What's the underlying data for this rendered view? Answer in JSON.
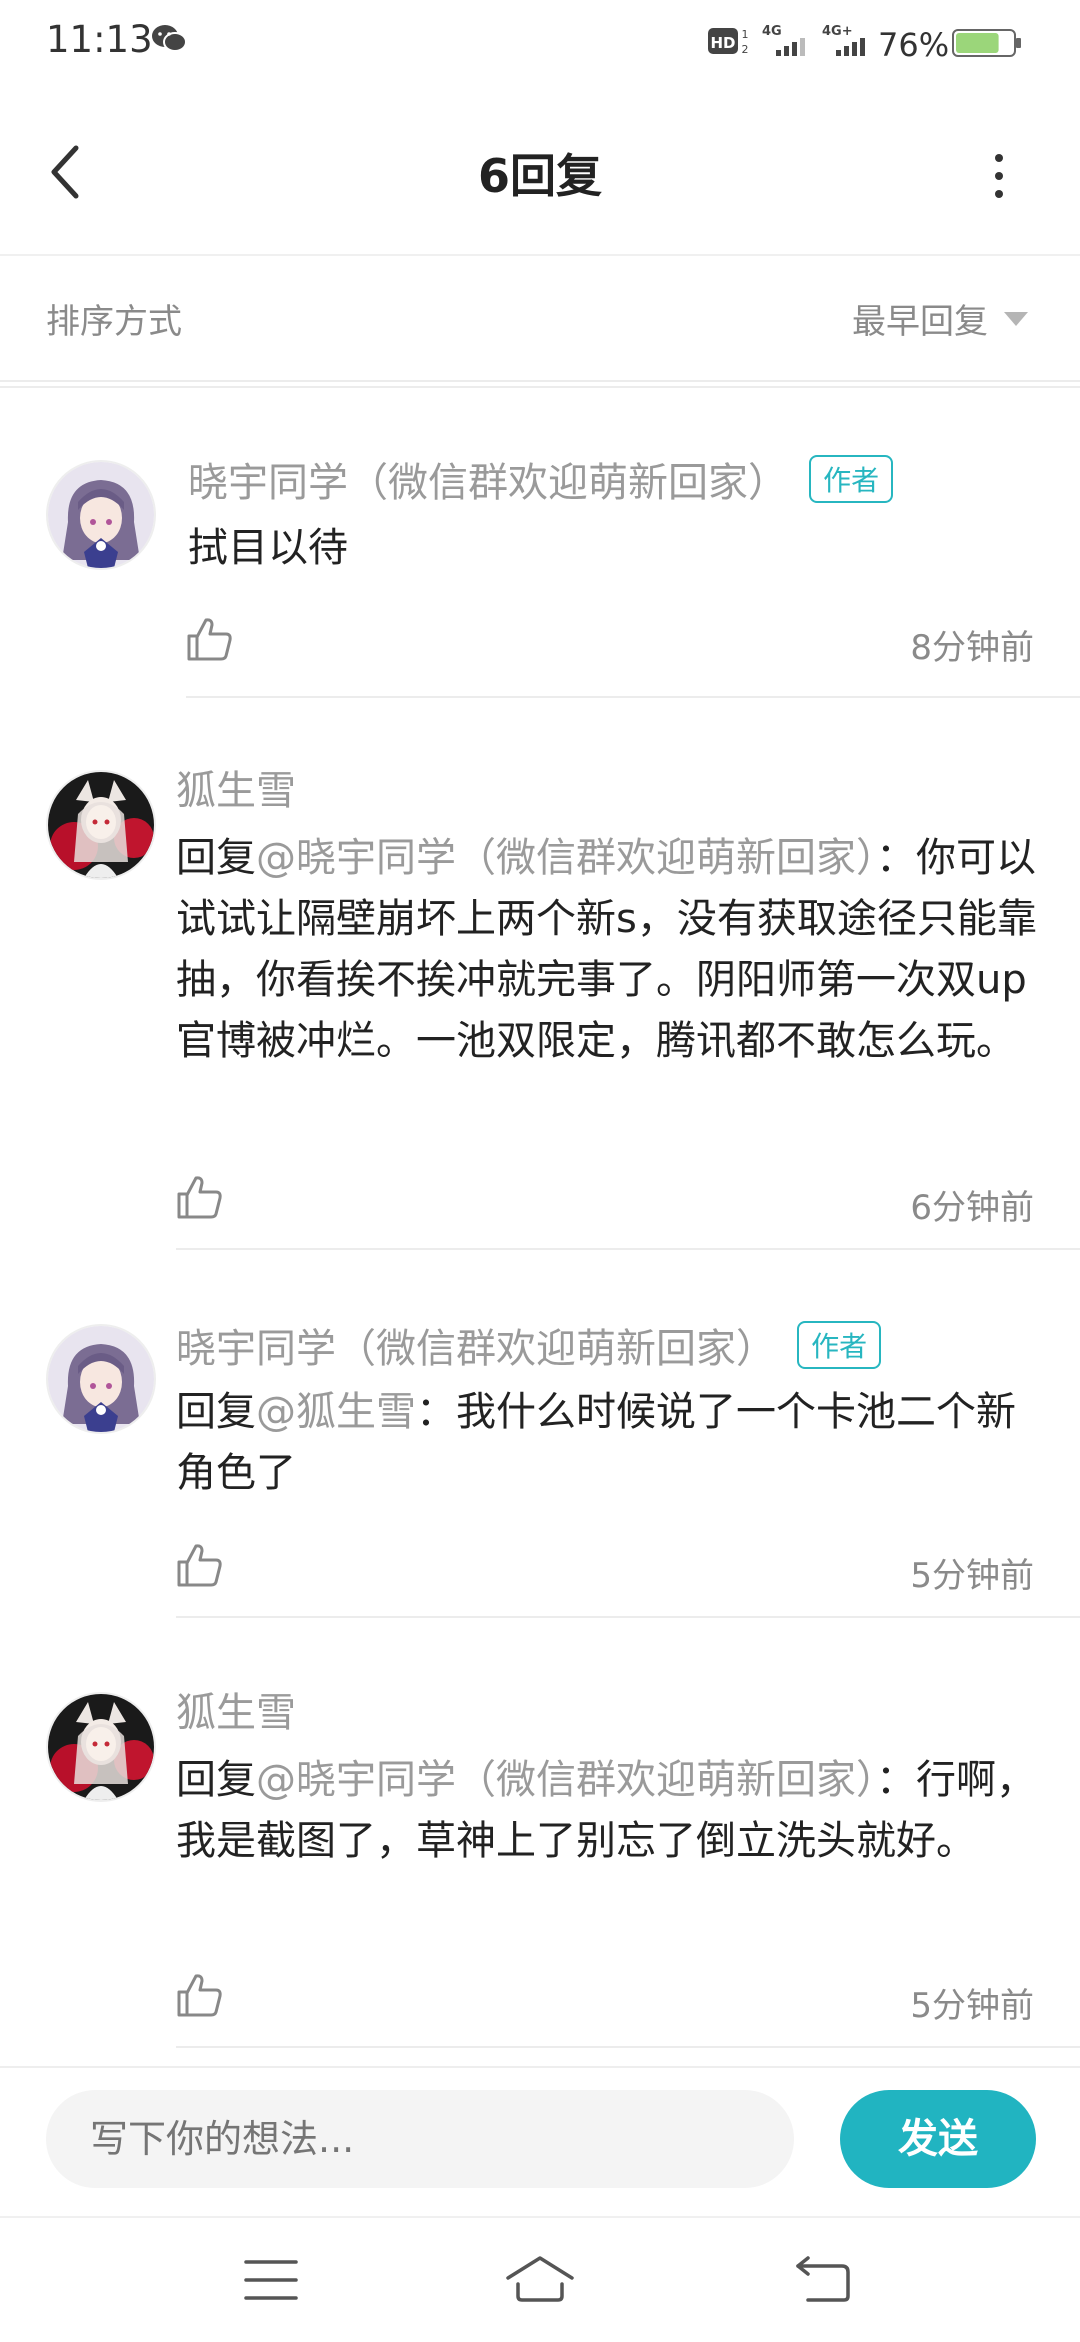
{
  "status_bar": {
    "time": "11:13",
    "network": "4G",
    "network_plus": "4G+",
    "battery_percent": "76%",
    "battery_level": 0.76,
    "icons": [
      "wechat-icon",
      "hd-voice-icon",
      "signal-icon",
      "signal-icon",
      "battery-icon"
    ]
  },
  "header": {
    "title": "6回复",
    "back_icon": "chevron-left-icon",
    "more_icon": "more-vertical-icon"
  },
  "sort": {
    "label": "排序方式",
    "selected": "最早回复"
  },
  "replies": [
    {
      "author": "晓宇同学（微信群欢迎萌新回家）",
      "badge": "作者",
      "reply_prefix": "",
      "mention": "",
      "text": "拭目以待",
      "time": "8分钟前"
    },
    {
      "author": "狐生雪",
      "badge": "",
      "reply_prefix": "回复",
      "mention": "@晓宇同学（微信群欢迎萌新回家）",
      "text": "：你可以试试让隔壁崩坏上两个新s，没有获取途径只能靠抽，你看挨不挨冲就完事了。阴阳师第一次双up官博被冲烂。一池双限定，腾讯都不敢怎么玩。",
      "time": "6分钟前"
    },
    {
      "author": "晓宇同学（微信群欢迎萌新回家）",
      "badge": "作者",
      "reply_prefix": "回复",
      "mention": "@狐生雪",
      "text": "：我什么时候说了一个卡池二个新角色了",
      "time": "5分钟前"
    },
    {
      "author": "狐生雪",
      "badge": "",
      "reply_prefix": "回复",
      "mention": "@晓宇同学（微信群欢迎萌新回家）",
      "text": "：行啊，我是截图了，草神上了别忘了倒立洗头就好。",
      "time": "5分钟前"
    }
  ],
  "composer": {
    "placeholder": "写下你的想法...",
    "send_label": "发送"
  },
  "colors": {
    "accent": "#21b4c1",
    "badge": "#27b6c0",
    "muted_text": "#9a9a9a"
  }
}
